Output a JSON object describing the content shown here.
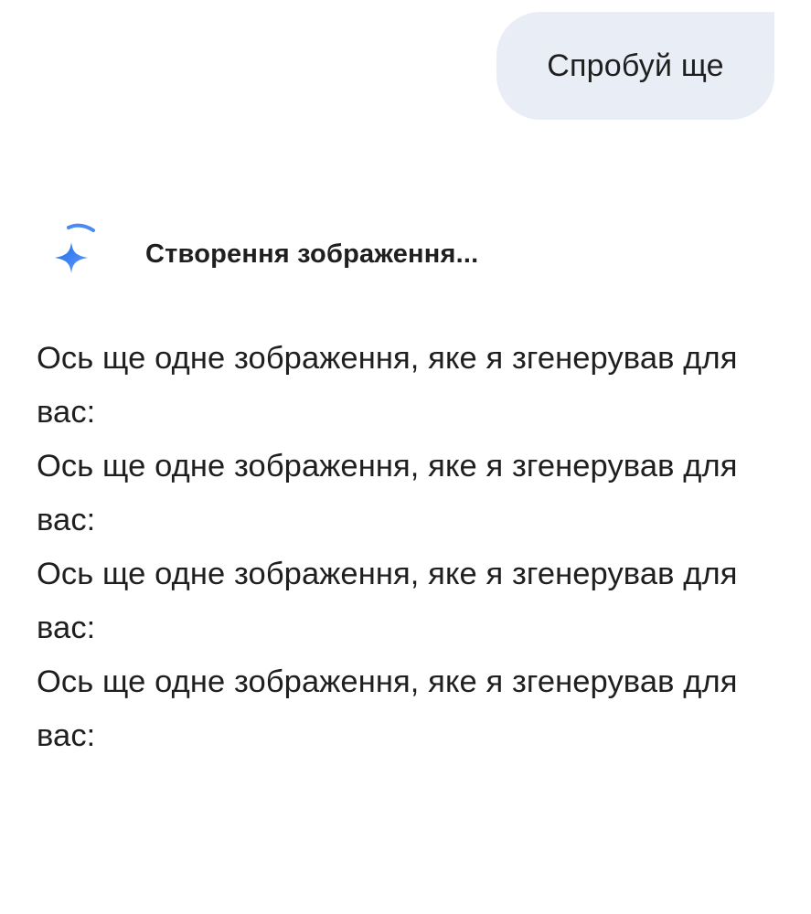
{
  "user_message": {
    "text": "Спробуй ще"
  },
  "generation_status": {
    "icon": "gemini-sparkle-icon",
    "text": "Створення зображення..."
  },
  "response": {
    "paragraphs": [
      "Ось ще одне зображення, яке я згенерував для вас:",
      "Ось ще одне зображення, яке я згенерував для вас:",
      "Ось ще одне зображення, яке я згенерував для вас:",
      "Ось ще одне зображення, яке я згенерував для вас:"
    ]
  },
  "colors": {
    "user_bubble_bg": "#e9eef6",
    "sparkle_blue": "#4285f4",
    "text": "#1f1f1f"
  }
}
